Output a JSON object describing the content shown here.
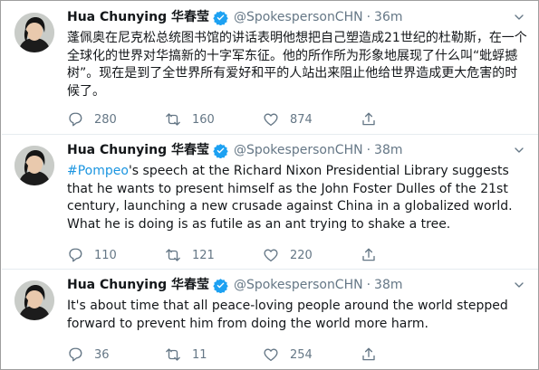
{
  "colors": {
    "name": "#14171a",
    "secondary": "#657786",
    "link": "#1b95e0",
    "verified": "#1da1f2",
    "divider": "#e6ecf0"
  },
  "icons": [
    "verified-badge-icon",
    "chevron-down-icon",
    "reply-icon",
    "retweet-icon",
    "like-icon",
    "share-icon"
  ],
  "tweets": [
    {
      "name": "Hua Chunying 华春莹",
      "handle": "@SpokespersonCHN",
      "dot": "·",
      "time": "36m",
      "hashtag": "",
      "text": "蓬佩奥在尼克松总统图书馆的讲话表明他想把自己塑造成21世纪的杜勒斯，在一个全球化的世界对华搞新的十字军东征。他的所作所为形象地展现了什么叫“蚍蜉撼树”。现在是到了全世界所有爱好和平的人站出来阻止他给世界造成更大危害的时候了。",
      "replies": "280",
      "retweets": "160",
      "likes": "874"
    },
    {
      "name": "Hua Chunying 华春莹",
      "handle": "@SpokespersonCHN",
      "dot": "·",
      "time": "38m",
      "hashtag": "#Pompeo",
      "text": "'s speech at the Richard Nixon Presidential Library suggests that he wants to present himself as the John Foster Dulles of the 21st century, launching a new crusade against China in a globalized world. What he is doing is as futile as an ant trying to shake a tree.",
      "replies": "110",
      "retweets": "121",
      "likes": "220"
    },
    {
      "name": "Hua Chunying 华春莹",
      "handle": "@SpokespersonCHN",
      "dot": "·",
      "time": "38m",
      "hashtag": "",
      "text": "It's about time that all peace-loving people around the world stepped forward to prevent him from doing the world more harm.",
      "replies": "36",
      "retweets": "11",
      "likes": "254"
    }
  ]
}
